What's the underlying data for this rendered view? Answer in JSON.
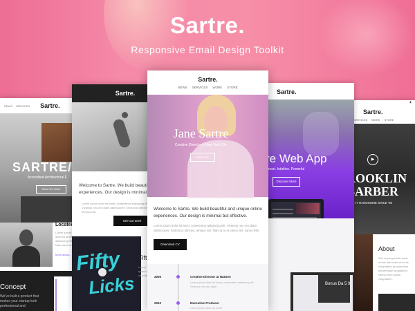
{
  "hero": {
    "title": "Sartre.",
    "subtitle": "Responsive Email Design Toolkit"
  },
  "card1": {
    "nav": [
      "NEWS",
      "SERVICES"
    ],
    "logo": "Sartre.",
    "heading": "SARTRE/PA",
    "subheading": "Accredited Architectural F",
    "button": "View Our Work",
    "located_title": "Located",
    "located_text": "Lorem ipsum dolor sit amet, adipiscing ellit. Nam lacus et...",
    "more_info": "More about...",
    "concept_title": "Concept",
    "concept_text": "We've built a product that makes your startup look professional and"
  },
  "card2": {
    "logo": "Sartre.",
    "welcome": "Welcome to Sartre. We build beautiful experiences. Our design is minimal",
    "lorem": "Lorem ipsum dolor sit amet, consectetur adipiscing elit. Vivamus nec orci diam ullamcorper. Sed lacus ultricies, tempus nisl.",
    "button": "See our work",
    "art_line1": "Fifty",
    "art_line2": "Licks",
    "side_title": "Fift",
    "side_text": "Lorem ipsum dolor sit make..."
  },
  "card3": {
    "logo": "Sartre.",
    "menu": [
      "NEWS",
      "SERVICES",
      "WORK",
      "STORE"
    ],
    "name": "Jane Sartre",
    "role": "Creative Director in New York City",
    "hero_button": "About Me",
    "welcome": "Welcome to Sartre. We build beautiful and unique online experiences. Our design is minimal but effective.",
    "lorem": "Lorem ipsum dolor sit amet, consectetur adipiscing elit. Vivamus nec orci diam ullamcorper. Sed lacus ultricies, tempus nisl. Nam arcu at varius nisl, varius felis.",
    "download": "Download CV",
    "timeline": [
      {
        "year": "2005",
        "job": "Creative Director at NatGeo",
        "text": "Lorem ipsum dolor sit amet, consectetur adipiscing elit. Vivamus nec orci diam"
      },
      {
        "year": "2010",
        "job": "Executive Producer",
        "text": "Lorem ipsum dolor sit amet"
      }
    ]
  },
  "card4": {
    "logo": "Sartre.",
    "heading": "re Web App",
    "subheading": "mart. Intuitive. Powerful",
    "button": "Discover More",
    "tablet_text": "Bonus Da 5 9"
  },
  "card5": {
    "logo": "Sartre.",
    "menu": [
      "SERVICES",
      "WORK",
      "STORE"
    ],
    "heading": "ROOKLIN BARBER",
    "subheading": "G IT HANDSOME SINCE '96",
    "about_title": "About",
    "about_text": "Sed ut perspiciatis unde omnis iste natus error sit voluptatem accusantium doloremque laudantium. Nemo enim ipsam voluptatem."
  },
  "colors": {
    "hero_pink": "#ee6d95",
    "accent_purple": "#8a3ee4",
    "dark": "#111111"
  }
}
